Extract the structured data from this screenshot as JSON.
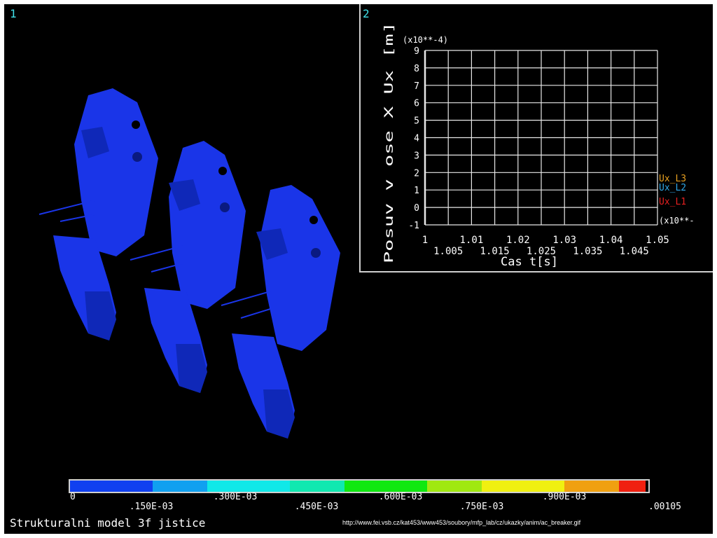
{
  "panels": {
    "left_number": "1",
    "right_number": "2"
  },
  "chart_data": {
    "type": "line",
    "y_multiplier": "(x10**-4)",
    "x_multiplier": "(x10**-",
    "ylabel": "Posuv v ose X Ux [m]",
    "xlabel": "Cas t[s]",
    "ylim": [
      -1,
      9
    ],
    "y_ticks": [
      "-1",
      "0",
      "1",
      "2",
      "3",
      "4",
      "5",
      "6",
      "7",
      "8",
      "9"
    ],
    "xlim": [
      1,
      1.05
    ],
    "x_ticks_top": [
      "1",
      "1.01",
      "1.02",
      "1.03",
      "1.04",
      "1.05"
    ],
    "x_ticks_bottom": [
      "1.005",
      "1.015",
      "1.025",
      "1.035",
      "1.045"
    ],
    "grid": true,
    "legend": [
      {
        "name": "Ux_L3",
        "color": "#e8a020"
      },
      {
        "name": "Ux_L2",
        "color": "#30a8e8"
      },
      {
        "name": "Ux_L1",
        "color": "#e82020"
      }
    ],
    "legend_placement": "right"
  },
  "colorbar": {
    "colors": [
      "#1040f0",
      "#10a0f0",
      "#10e8e8",
      "#10e8b0",
      "#10e810",
      "#a0e810",
      "#f0f010",
      "#f0a010",
      "#f02010"
    ],
    "labels_lower": [
      "0",
      ".300E-03",
      ".600E-03",
      ".900E-03"
    ],
    "labels_upper": [
      ".150E-03",
      ".450E-03",
      ".750E-03",
      ".00105"
    ]
  },
  "model": {
    "color": "#1a35e8"
  },
  "caption": "Strukturalni model 3f jistice",
  "source": "http://www.fei.vsb.cz/kat453/www453/soubory/mfp_lab/cz/ukazky/anim/ac_breaker.gif"
}
